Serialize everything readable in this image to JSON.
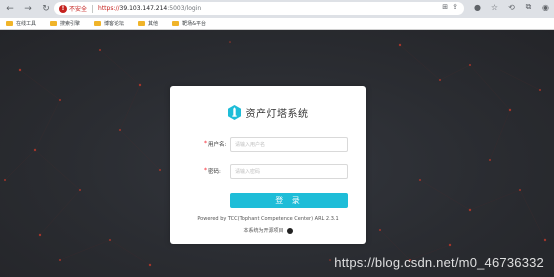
{
  "browser": {
    "nav": {
      "back_icon": "←",
      "forward_icon": "→",
      "reload_icon": "↻"
    },
    "security_warning": "不安全",
    "url": {
      "scheme": "https://",
      "host": "39.103.147.214",
      "path": ":5003/login"
    },
    "bookmarks": [
      {
        "label": "在线工具"
      },
      {
        "label": "搜索引擎"
      },
      {
        "label": "博客论坛"
      },
      {
        "label": "其他"
      },
      {
        "label": "靶场&平台"
      }
    ]
  },
  "login": {
    "app_title": "资产灯塔系统",
    "username": {
      "label": "用户名:",
      "placeholder": "请输入用户名",
      "value": ""
    },
    "password": {
      "label": "密码:",
      "placeholder": "请输入密码",
      "value": ""
    },
    "submit_label": "登 录",
    "powered_by": "Powered by TCC(Tophant Competence Center) ARL 2.3.1",
    "open_source_note": "本系统为开源项目"
  },
  "watermark": "https://blog.csdn.net/m0_46736332",
  "colors": {
    "accent": "#1ebdd8",
    "background": "#2b2d31",
    "required_mark": "#f5222d",
    "network_dots": "#c0392b"
  }
}
